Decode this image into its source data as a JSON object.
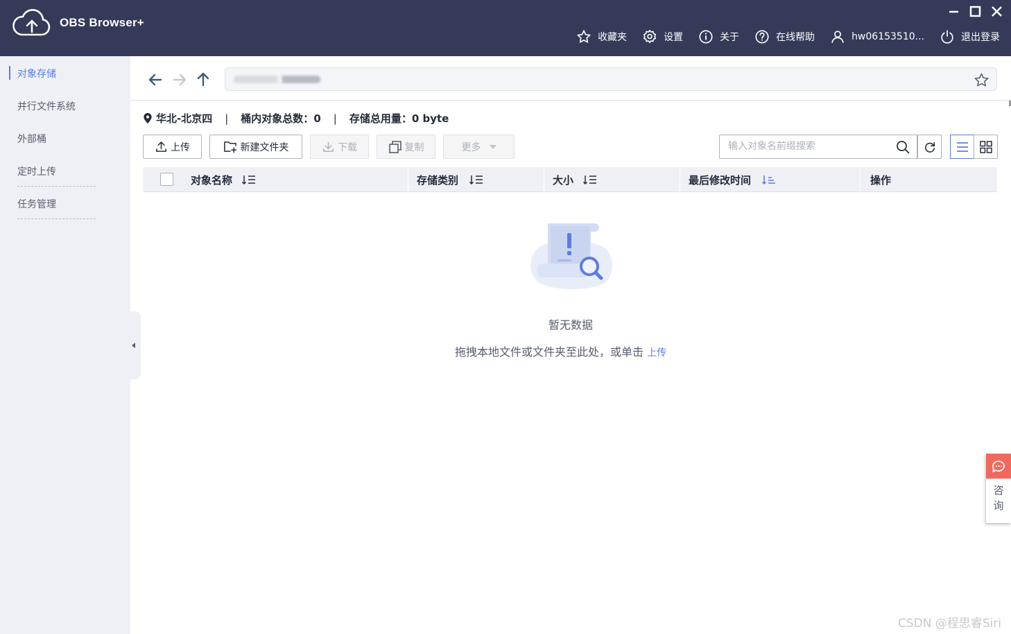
{
  "app": {
    "title": "OBS Browser+"
  },
  "header": {
    "favorites": "收藏夹",
    "settings": "设置",
    "about": "关于",
    "help": "在线帮助",
    "user": "hw06153510...",
    "logout": "退出登录"
  },
  "sidebar": {
    "items": [
      {
        "label": "对象存储",
        "active": true
      },
      {
        "label": "并行文件系统"
      },
      {
        "label": "外部桶"
      },
      {
        "label": "定时上传"
      },
      {
        "label": "任务管理"
      }
    ]
  },
  "info": {
    "region": "华北-北京四",
    "total_label": "桶内对象总数：",
    "total_value": "0",
    "usage_label": "存储总用量：",
    "usage_value": "0 byte"
  },
  "toolbar": {
    "upload": "上传",
    "new_folder": "新建文件夹",
    "download": "下载",
    "copy": "复制",
    "more": "更多",
    "search_placeholder": "输入对象名前缀搜索"
  },
  "table": {
    "columns": [
      "对象名称",
      "存储类别",
      "大小",
      "最后修改时间",
      "操作"
    ]
  },
  "empty": {
    "title": "暂无数据",
    "desc": "拖拽本地文件或文件夹至此处，或单击",
    "link": "上传"
  },
  "consult": {
    "label": "咨询",
    "line1": "咨",
    "line2": "询"
  },
  "watermark": "CSDN @程思睿Siri",
  "colors": {
    "header": "#343a58",
    "accent": "#5e7ce0",
    "sidebar": "#eef0f5",
    "consult": "#f0695e"
  }
}
